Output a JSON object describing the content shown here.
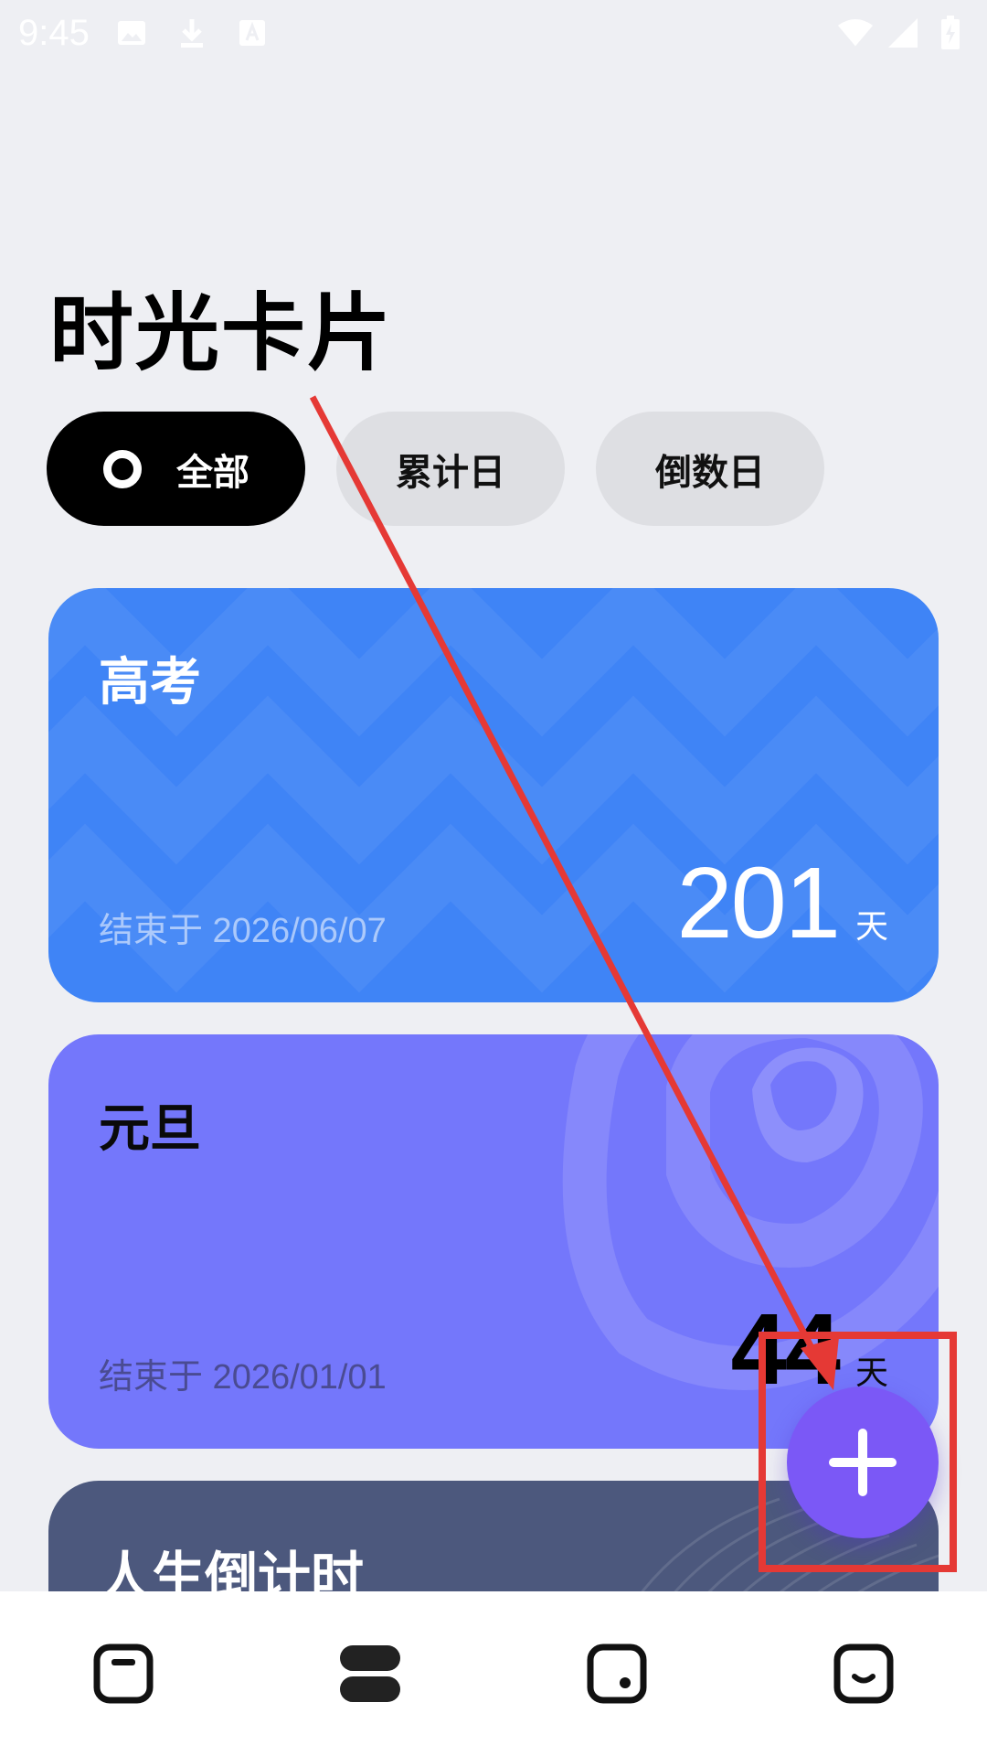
{
  "status_bar": {
    "time": "9:45",
    "icons": [
      "image-icon",
      "download-icon",
      "font-icon",
      "wifi-icon",
      "signal-icon",
      "battery-charging-icon"
    ]
  },
  "page": {
    "title": "时光卡片"
  },
  "filters": [
    {
      "label": "全部",
      "active": true
    },
    {
      "label": "累计日",
      "active": false
    },
    {
      "label": "倒数日",
      "active": false
    }
  ],
  "cards": [
    {
      "title": "高考",
      "end_text": "结束于 2026/06/07",
      "days": "201",
      "unit": "天",
      "color": "#3F84F6"
    },
    {
      "title": "元旦",
      "end_text": "结束于 2026/01/01",
      "days": "44",
      "unit": "天",
      "color": "#7477FB"
    },
    {
      "title": "人生倒计时",
      "color": "#4C587D"
    }
  ],
  "fab": {
    "icon": "plus-icon",
    "color": "#7B58F6"
  },
  "bottom_nav": [
    {
      "icon": "card-top-bar-icon"
    },
    {
      "icon": "stacked-cards-icon",
      "active": true
    },
    {
      "icon": "card-dot-icon"
    },
    {
      "icon": "card-smile-icon"
    }
  ],
  "colors": {
    "background": "#EEEFF3",
    "annotation": "#E53935"
  }
}
